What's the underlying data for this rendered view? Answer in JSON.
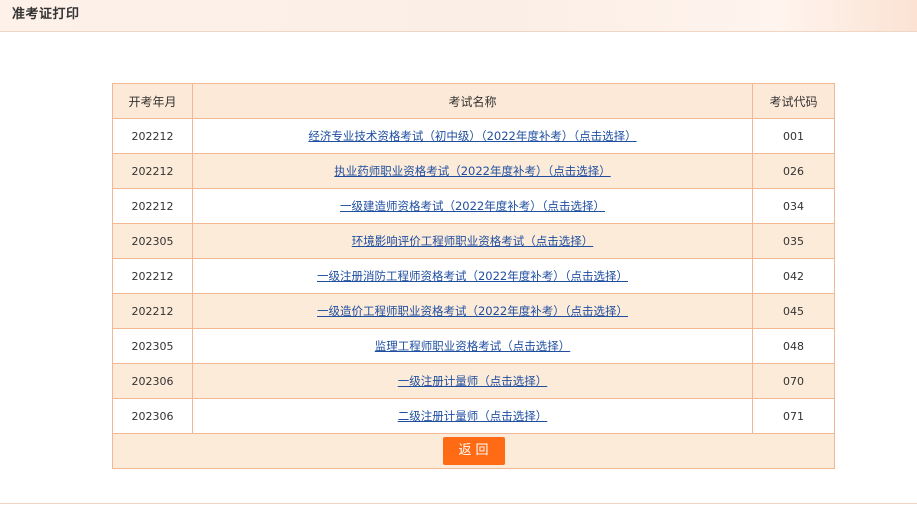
{
  "header": {
    "title": "准考证打印"
  },
  "table": {
    "columns": [
      "开考年月",
      "考试名称",
      "考试代码"
    ],
    "rows": [
      {
        "year_month": "202212",
        "name": "经济专业技术资格考试（初中级）（2022年度补考）（点击选择）",
        "code": "001"
      },
      {
        "year_month": "202212",
        "name": "执业药师职业资格考试（2022年度补考）（点击选择）",
        "code": "026"
      },
      {
        "year_month": "202212",
        "name": "一级建造师资格考试（2022年度补考）（点击选择）",
        "code": "034"
      },
      {
        "year_month": "202305",
        "name": "环境影响评价工程师职业资格考试（点击选择）",
        "code": "035"
      },
      {
        "year_month": "202212",
        "name": "一级注册消防工程师资格考试（2022年度补考）（点击选择）",
        "code": "042"
      },
      {
        "year_month": "202212",
        "name": "一级造价工程师职业资格考试（2022年度补考）（点击选择）",
        "code": "045"
      },
      {
        "year_month": "202305",
        "name": "监理工程师职业资格考试（点击选择）",
        "code": "048"
      },
      {
        "year_month": "202306",
        "name": "一级注册计量师（点击选择）",
        "code": "070"
      },
      {
        "year_month": "202306",
        "name": "二级注册计量师（点击选择）",
        "code": "071"
      }
    ]
  },
  "actions": {
    "return_label": "返回"
  },
  "colors": {
    "accent": "#ff6a14",
    "link": "#1f4fa0",
    "row_alt": "#fdebd9",
    "border": "#f2b894"
  }
}
